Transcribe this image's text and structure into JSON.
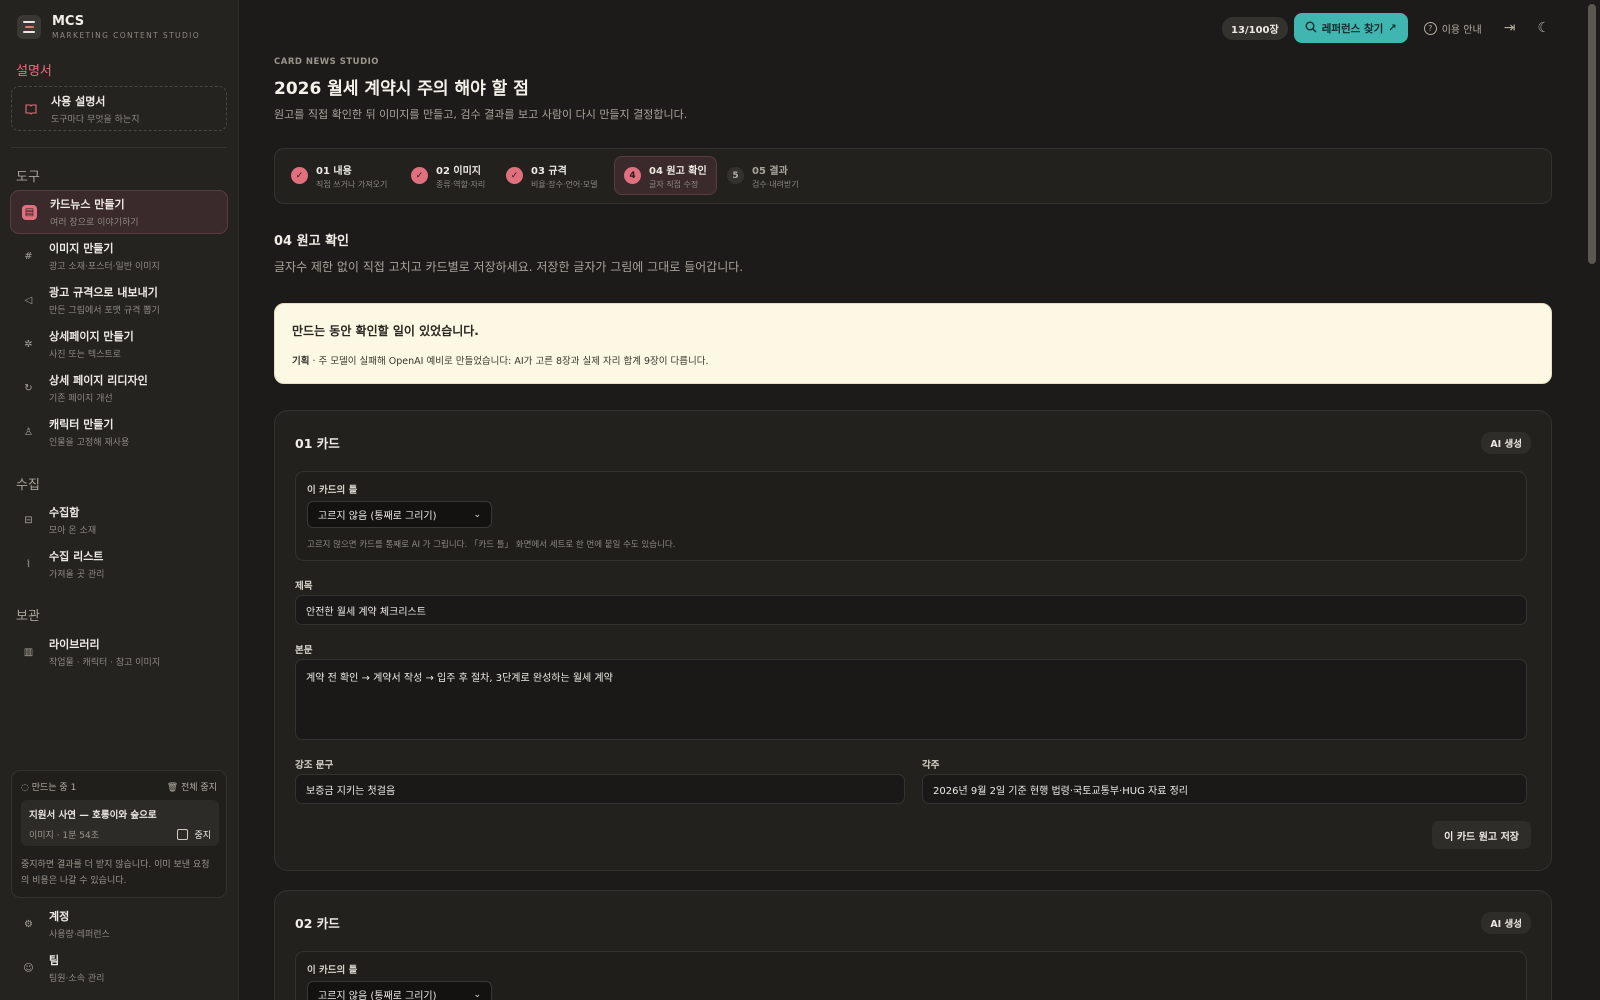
{
  "brand": {
    "name": "MCS",
    "subtitle": "MARKETING CONTENT STUDIO"
  },
  "sidebar": {
    "manual_section": "설명서",
    "manual": {
      "title": "사용 설명서",
      "sub": "도구마다 무엇을 하는지"
    },
    "tools_section": "도구",
    "tools": [
      {
        "title": "카드뉴스 만들기",
        "sub": "여러 장으로 이야기하기",
        "active": true
      },
      {
        "title": "이미지 만들기",
        "sub": "광고 소재·포스터·일반 이미지"
      },
      {
        "title": "광고 규격으로 내보내기",
        "sub": "만든 그림에서 포맷 규격 뽑기"
      },
      {
        "title": "상세페이지 만들기",
        "sub": "사진 또는 텍스트로"
      },
      {
        "title": "상세 페이지 리디자인",
        "sub": "기존 페이지 개선"
      },
      {
        "title": "캐릭터 만들기",
        "sub": "인물을 고정해 재사용"
      }
    ],
    "collect_section": "수집",
    "collect": [
      {
        "title": "수집함",
        "sub": "모아 온 소재"
      },
      {
        "title": "수집 리스트",
        "sub": "가져올 곳 관리"
      }
    ],
    "archive_section": "보관",
    "archive": [
      {
        "title": "라이브러리",
        "sub": "작업물 · 캐릭터 · 참고 이미지"
      }
    ],
    "progress": {
      "status": "만드는 중 1",
      "stop_all": "전체 중지",
      "job_title": "지원서 사연 — 호롱이와 숲으로",
      "job_meta": "이미지 · 1분 54초",
      "job_stop": "중지",
      "note": "중지하면 결과를 더 받지 않습니다. 이미 보낸 요청의 비용은 나갈 수 있습니다."
    },
    "bottom": [
      {
        "title": "계정",
        "sub": "사용량·레퍼런스"
      },
      {
        "title": "팀",
        "sub": "팀원·소속 관리"
      }
    ]
  },
  "topbar": {
    "count": "13/100장",
    "ref_button": "레퍼런스 찾기",
    "guide": "이용 안내"
  },
  "page": {
    "eyebrow": "CARD NEWS STUDIO",
    "title": "2026 월세 계약시 주의 해야 할 점",
    "description": "원고를 직접 확인한 뒤 이미지를 만들고, 검수 결과를 보고 사람이 다시 만들지 결정합니다."
  },
  "steps": [
    {
      "num": "✓",
      "title": "01 내용",
      "sub": "직접 쓰거나 가져오기",
      "state": "done"
    },
    {
      "num": "✓",
      "title": "02 이미지",
      "sub": "종류·역할·자리",
      "state": "done"
    },
    {
      "num": "✓",
      "title": "03 규격",
      "sub": "비율·장수·언어·모델",
      "state": "done"
    },
    {
      "num": "4",
      "title": "04 원고 확인",
      "sub": "글자 직접 수정",
      "state": "current"
    },
    {
      "num": "5",
      "title": "05 결과",
      "sub": "검수·내려받기",
      "state": "todo"
    }
  ],
  "section": {
    "title": "04 원고 확인",
    "description": "글자수 제한 없이 직접 고치고 카드별로 저장하세요. 저장한 글자가 그림에 그대로 들어갑니다."
  },
  "notice": {
    "title": "만드는 동안 확인할 일이 있었습니다.",
    "label": "기획",
    "body": " · 주 모델이 실패해 OpenAI 예비로 만들었습니다: AI가 고른 8장과 실제 자리 합계 9장이 다릅니다."
  },
  "cards": [
    {
      "title": "01 카드",
      "chip": "AI 생성",
      "frame_label": "이 카드의 틀",
      "frame_select": "고르지 않음 (통째로 그리기)",
      "frame_hint": "고르지 않으면 카드를 통째로 AI 가 그립니다. 「카드 틀」 화면에서 세트로 한 번에 붙일 수도 있습니다.",
      "title_label": "제목",
      "title_value": "안전한 월세 계약 체크리스트",
      "body_label": "본문",
      "body_value": "계약 전 확인 → 계약서 작성 → 입주 후 절차, 3단계로 완성하는 월세 계약",
      "emphasis_label": "강조 문구",
      "emphasis_value": "보증금 지키는 첫걸음",
      "footnote_label": "각주",
      "footnote_value": "2026년 9월 2일 기준 현행 법령·국토교통부·HUG 자료 정리",
      "save_label": "이 카드 원고 저장"
    },
    {
      "title": "02 카드",
      "chip": "AI 생성",
      "frame_label": "이 카드의 틀",
      "frame_select": "고르지 않음 (통째로 그리기)"
    }
  ]
}
